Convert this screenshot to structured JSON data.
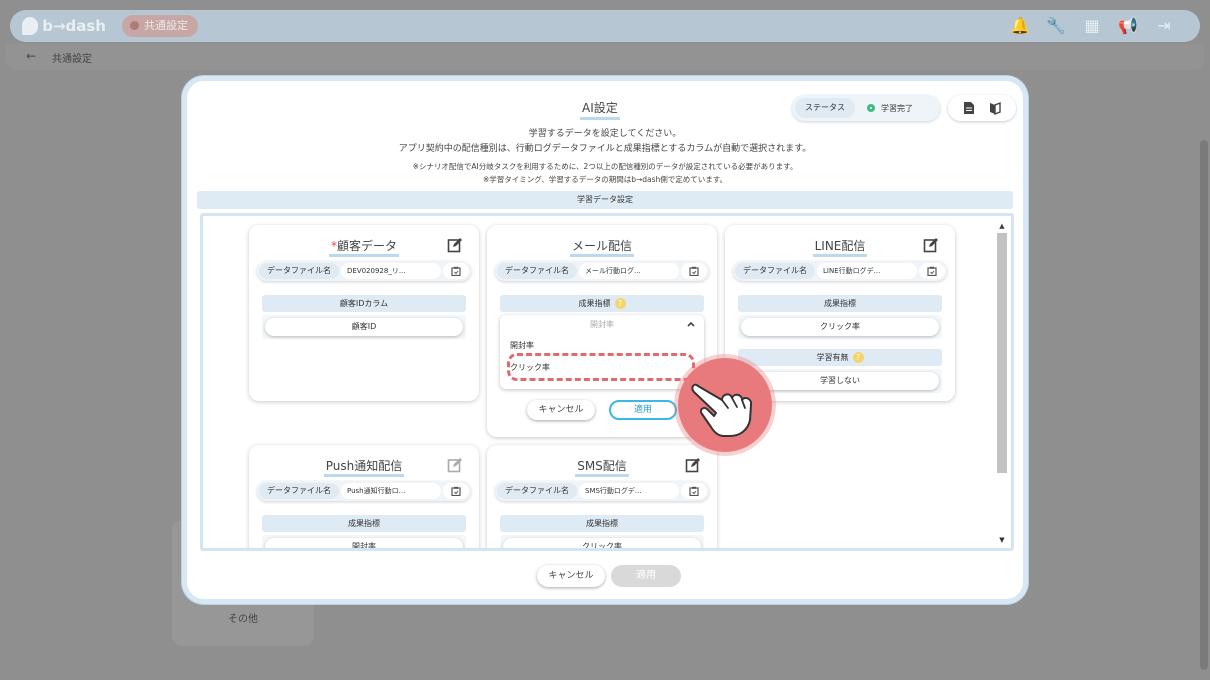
{
  "app": {
    "logo_text": "b→dash",
    "chip_label": "共通設定",
    "breadcrumb": "共通設定",
    "side_other": "その他"
  },
  "modal": {
    "title": "AI設定",
    "status": {
      "label": "ステータス",
      "value": "学習完了",
      "color": "#3ebd7e"
    },
    "description_lines": [
      "学習するデータを設定してください。",
      "アプリ契約中の配信種別は、行動ログデータファイルと成果指標とするカラムが自動で選択されます。"
    ],
    "note_lines": [
      "※シナリオ配信でAI分岐タスクを利用するために、2つ以上の配信種別のデータが設定されている必要があります。",
      "※学習タイミング、学習するデータの期間はb→dash側で定めています。"
    ],
    "section_title": "学習データ設定",
    "footer": {
      "cancel": "キャンセル",
      "apply": "適用"
    }
  },
  "cards": {
    "customer": {
      "required_mark": "*",
      "title": "顧客データ",
      "file_label": "データファイル名",
      "file_name": "DEV020928_リ...",
      "field_label": "顧客IDカラム",
      "field_value": "顧客ID"
    },
    "mail": {
      "title": "メール配信",
      "file_label": "データファイル名",
      "file_name": "メール行動ログ...",
      "field_label": "成果指標",
      "dropdown": {
        "selected": "開封率",
        "options": [
          "開封率",
          "クリック率"
        ],
        "highlighted": "クリック率"
      },
      "cancel": "キャンセル",
      "apply": "適用"
    },
    "line": {
      "title": "LINE配信",
      "file_label": "データファイル名",
      "file_name": "LINE行動ログデ...",
      "field_label": "成果指標",
      "field_value": "クリック率",
      "learn_label": "学習有無",
      "learn_value": "学習しない"
    },
    "push": {
      "title": "Push通知配信",
      "file_label": "データファイル名",
      "file_name": "Push通知行動ロ...",
      "field_label": "成果指標",
      "field_value": "開封率"
    },
    "sms": {
      "title": "SMS配信",
      "file_label": "データファイル名",
      "file_name": "SMS行動ログデ...",
      "field_label": "成果指標",
      "field_value": "クリック率"
    }
  },
  "colors": {
    "accent": "#3bb7e5",
    "highlight": "#e06a70",
    "required": "#e54b4b"
  }
}
